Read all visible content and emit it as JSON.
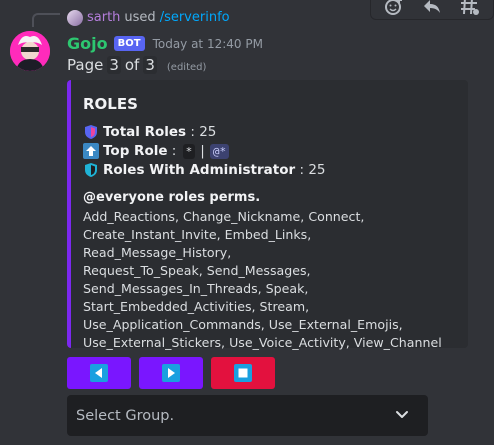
{
  "reply": {
    "user": "sarth",
    "used": "used",
    "command": "/serverinfo"
  },
  "message": {
    "username": "Gojo",
    "bot_tag": "BOT",
    "timestamp": "Today at 12:40 PM",
    "page_prefix": "Page",
    "page_current": "3",
    "page_of": "of",
    "page_total": "3",
    "edited": "(edited)"
  },
  "embed": {
    "color": "#7c28f0",
    "title": "ROLES",
    "total_roles_label": "Total Roles",
    "total_roles_sep": " : ",
    "total_roles_value": "25",
    "top_role_label": "Top Role",
    "top_role_sep": " : ",
    "top_role_code": "*",
    "top_role_pipe": "|",
    "top_role_mention": "@*",
    "admin_label": "Roles With Administrator",
    "admin_sep": " : ",
    "admin_value": "25",
    "perms_title": "@everyone roles perms.",
    "perms_text": "Add_Reactions, Change_Nickname, Connect,\nCreate_Instant_Invite, Embed_Links, Read_Message_History,\nRequest_To_Speak, Send_Messages,\nSend_Messages_In_Threads, Speak,\nStart_Embedded_Activities, Stream,\nUse_Application_Commands, Use_External_Emojis,\nUse_External_Stickers, Use_Voice_Activity, View_Channel"
  },
  "buttons": [
    {
      "name": "previous",
      "icon": "left-arrow-icon",
      "color": "#7a16ff"
    },
    {
      "name": "next",
      "icon": "right-arrow-icon",
      "color": "#7a16ff"
    },
    {
      "name": "stop",
      "icon": "stop-icon",
      "color": "#e3113e"
    }
  ],
  "select": {
    "placeholder": "Select Group."
  },
  "toolbar": {
    "icons": [
      "add-reaction-icon",
      "reply-icon",
      "create-thread-icon"
    ]
  }
}
